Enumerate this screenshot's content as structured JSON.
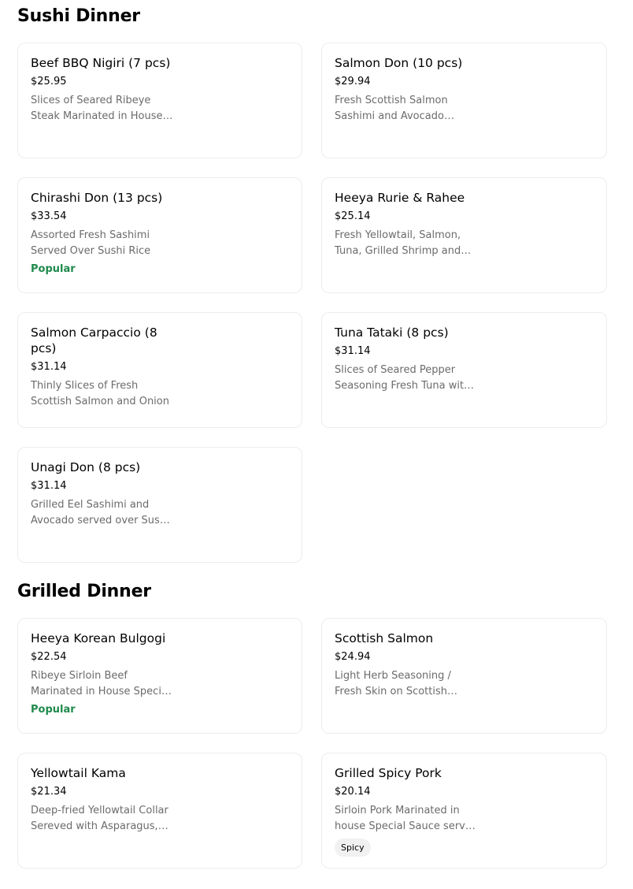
{
  "sections": [
    {
      "title": "Sushi Dinner",
      "items": [
        {
          "name": "Beef BBQ Nigiri (7 pcs)",
          "price": "$25.95",
          "description": "Slices of Seared Ribeye Steak Marinated in House Special Sauce",
          "badge": ""
        },
        {
          "name": "Salmon Don (10 pcs)",
          "price": "$29.94",
          "description": "Fresh Scottish Salmon Sashimi and Avocado served over Sushi Rice",
          "badge": ""
        },
        {
          "name": "Chirashi Don (13 pcs)",
          "price": "$33.54",
          "description": "Assorted Fresh Sashimi Served Over Sushi Rice",
          "badge": "Popular"
        },
        {
          "name": "Heeya Rurie & Rahee",
          "price": "$25.14",
          "description": "Fresh Yellowtail, Salmon, Tuna, Grilled Shrimp and Avocado",
          "badge": ""
        },
        {
          "name": "Salmon Carpaccio (8 pcs)",
          "price": "$31.14",
          "description": "Thinly Slices of Fresh Scottish Salmon and Onion",
          "badge": ""
        },
        {
          "name": "Tuna Tataki (8 pcs)",
          "price": "$31.14",
          "description": "Slices of Seared Pepper Seasoning Fresh Tuna with Ponzu",
          "badge": ""
        },
        {
          "name": "Unagi Don (8 pcs)",
          "price": "$31.14",
          "description": "Grilled Eel Sashimi and Avocado served over Sushi Rice",
          "badge": ""
        }
      ]
    },
    {
      "title": "Grilled Dinner",
      "items": [
        {
          "name": "Heeya Korean Bulgogi",
          "price": "$22.54",
          "description": "Ribeye Sirloin Beef Marinated in House Special Sauce",
          "badge": "Popular"
        },
        {
          "name": "Scottish Salmon",
          "price": "$24.94",
          "description": "Light Herb Seasoning / Fresh Skin on Scottish Salmon",
          "badge": ""
        },
        {
          "name": "Yellowtail Kama",
          "price": "$21.34",
          "description": "Deep-fried Yellowtail Collar Sereved with Asparagus, Ponzu",
          "badge": ""
        },
        {
          "name": "Grilled Spicy Pork",
          "price": "$20.14",
          "description": "Sirloin Pork Marinated in house Special Sauce served with rice",
          "badge": "Spicy"
        }
      ]
    }
  ]
}
